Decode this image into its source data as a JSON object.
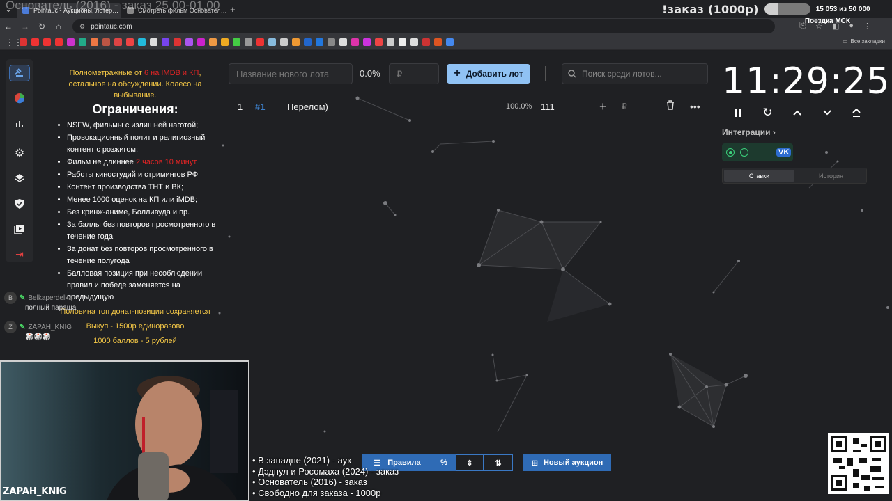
{
  "browser": {
    "tabs": [
      {
        "title": "Pointauc - Аукционы, лотер…",
        "active": true
      },
      {
        "title": "Смотреть фильм Основател…",
        "active": false
      }
    ],
    "overlay_title": "Основатель (2016) - заказ 25.00-01.00",
    "url": "pointauc.com",
    "bookmarks_all": "Все закладки"
  },
  "stream": {
    "order_title": "!заказ (1000р)",
    "progress_count": "15 053  из 50 000",
    "progress_fraction": 0.3,
    "trip_label": "Поездка МСК",
    "streamer_name": "ZAPAH_KNIG",
    "orders": [
      "• В западне (2021) - аук",
      "• Дэдпул и Росомаха (2024) - заказ",
      "• Основатель (2016) - заказ",
      "• Свободно для заказа - 1000р"
    ]
  },
  "sidebar": {
    "items": [
      {
        "icon": "gavel-icon",
        "active": true
      },
      {
        "icon": "pie-chart-icon"
      },
      {
        "icon": "bar-chart-icon"
      },
      {
        "icon": "gear-icon"
      },
      {
        "icon": "layers-icon"
      },
      {
        "icon": "shield-icon"
      },
      {
        "icon": "video-icon"
      },
      {
        "icon": "logout-icon"
      }
    ]
  },
  "rules": {
    "intro_a": "Полнометражные от ",
    "intro_red": "6 на IMDB и КП",
    "intro_b": ", остальное на обсуждении. Колесо на выбывание.",
    "heading": "Ограничения:",
    "items": [
      "NSFW, фильмы с излишней наготой;",
      "Провокационный полит и религиозный контент с розжигом;",
      "Фильм не длиннее ",
      "Работы киностудий и стримингов РФ",
      "Контент производства ТНТ и ВК;",
      "Менее 1000 оценок на КП или iMDB;",
      "Без кринж-аниме, Болливуда и пр.",
      "За баллы без повторов просмотренного в течение года",
      "За донат без повторов просмотренного в течение полугода",
      "Балловая позиция при несоблюдении правил и победе заменяется на предыдущую"
    ],
    "length_red": "2 часов 10 минут",
    "tail": [
      "Половина топ донат-позиции сохраняется",
      "Выкуп - 1500р единоразово",
      "1000 баллов - 5 рублей"
    ]
  },
  "chat": [
    {
      "avatar": "B",
      "user": "Belkaperdelka",
      "message": "полный параша"
    },
    {
      "avatar": "Z",
      "user": "ZAPAH_KNIG",
      "message": "🎲🎲🎲"
    }
  ],
  "lot_form": {
    "name_placeholder": "Название нового лота",
    "percent": "0.0%",
    "amount_placeholder": "₽",
    "add_label": "Добавить лот",
    "search_placeholder": "Поиск среди лотов..."
  },
  "lots": [
    {
      "index": "1",
      "hash_id": "#1",
      "title": "Перелом)",
      "percent": "100.0%",
      "amount": "111",
      "currency": "₽"
    }
  ],
  "timer": {
    "value": "11:29:25"
  },
  "integrations": {
    "label": "Интеграции",
    "vk": "VK"
  },
  "bids_tabs": {
    "bets": "Ставки",
    "history": "История"
  },
  "bottom_toolbar": {
    "rules_label": "Правила",
    "new_auction_label": "Новый аукцион"
  },
  "colors": {
    "accent": "#90c2f4",
    "blue_button": "#2f6bb5",
    "warning": "#f5c846",
    "danger": "#e02424",
    "online": "#3cd17c"
  }
}
